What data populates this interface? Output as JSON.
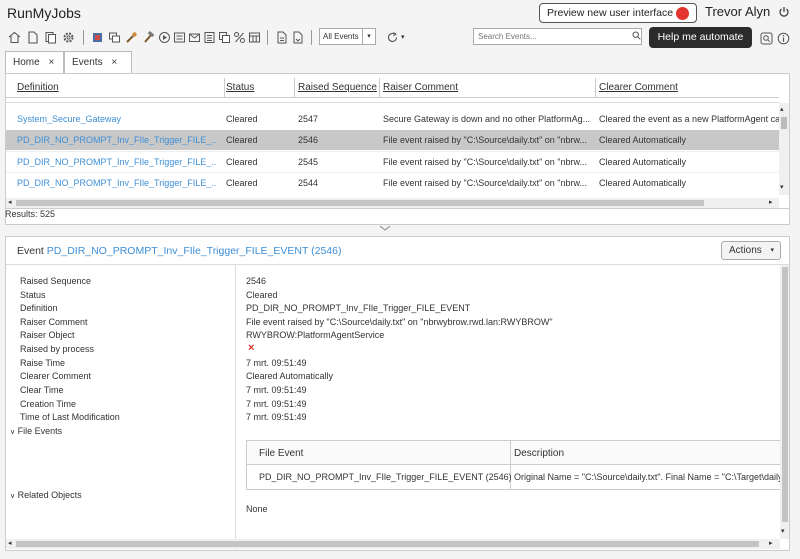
{
  "app": {
    "title": "RunMyJobs",
    "preview_button": "Preview new user interface",
    "user": "Trevor Alyn",
    "help_button": "Help me automate"
  },
  "toolbar": {
    "filter_value": "All Events",
    "search_placeholder": "Search Events..."
  },
  "tabs": [
    {
      "label": "Home",
      "close": "×"
    },
    {
      "label": "Events",
      "close": "×"
    }
  ],
  "table": {
    "columns": [
      "Definition",
      "Status",
      "Raised Sequence",
      "Raiser Comment",
      "Clearer Comment"
    ],
    "rows": [
      {
        "definition": "System_Secure_Gateway",
        "status": "Cleared",
        "sequence": "2547",
        "raiser": "Secure Gateway is down and no other PlatformAg...",
        "clearer": "Cleared the event as a new PlatformAgent car"
      },
      {
        "definition": "PD_DIR_NO_PROMPT_Inv_FIle_Trigger_FILE_...",
        "status": "Cleared",
        "sequence": "2546",
        "raiser": "File event raised by \"C:\\Source\\daily.txt\" on \"nbrw...",
        "clearer": "Cleared Automatically",
        "selected": true
      },
      {
        "definition": "PD_DIR_NO_PROMPT_Inv_FIle_Trigger_FILE_...",
        "status": "Cleared",
        "sequence": "2545",
        "raiser": "File event raised by \"C:\\Source\\daily.txt\" on \"nbrw...",
        "clearer": "Cleared Automatically"
      },
      {
        "definition": "PD_DIR_NO_PROMPT_Inv_FIle_Trigger_FILE_...",
        "status": "Cleared",
        "sequence": "2544",
        "raiser": "File event raised by \"C:\\Source\\daily.txt\" on \"nbrw...",
        "clearer": "Cleared Automatically"
      }
    ],
    "results": "Results: 525"
  },
  "detail": {
    "title_prefix": "Event ",
    "title_link": "PD_DIR_NO_PROMPT_Inv_FIle_Trigger_FILE_EVENT (2546)",
    "actions_label": "Actions",
    "fields": [
      {
        "label": "Raised Sequence",
        "value": "2546"
      },
      {
        "label": "Status",
        "value": "Cleared"
      },
      {
        "label": "Definition",
        "value": "PD_DIR_NO_PROMPT_Inv_FIle_Trigger_FILE_EVENT",
        "link": true
      },
      {
        "label": "Raiser Comment",
        "value": "File event raised by \"C:\\Source\\daily.txt\" on \"nbrwybrow.rwd.lan:RWYBROW\""
      },
      {
        "label": "Raiser Object",
        "value": "RWYBROW:PlatformAgentService",
        "link": true
      },
      {
        "label": "Raised by process",
        "value": "×",
        "red": true
      },
      {
        "label": "Raise Time",
        "value": "7 mrt. 09:51:49"
      },
      {
        "label": "Clearer Comment",
        "value": "Cleared Automatically"
      },
      {
        "label": "Clear Time",
        "value": "7 mrt. 09:51:49"
      },
      {
        "label": "Creation Time",
        "value": "7 mrt. 09:51:49"
      },
      {
        "label": "Time of Last Modification",
        "value": "7 mrt. 09:51:49"
      }
    ],
    "file_events_label": "File Events",
    "file_table": {
      "columns": [
        "File Event",
        "Description"
      ],
      "row": {
        "event": "PD_DIR_NO_PROMPT_Inv_FIle_Trigger_FILE_EVENT (2546)",
        "description": "Original Name = \"C:\\Source\\daily.txt\". Final Name = \"C:\\Target\\daily.t"
      }
    },
    "related_label": "Related Objects",
    "related_value": "None"
  }
}
